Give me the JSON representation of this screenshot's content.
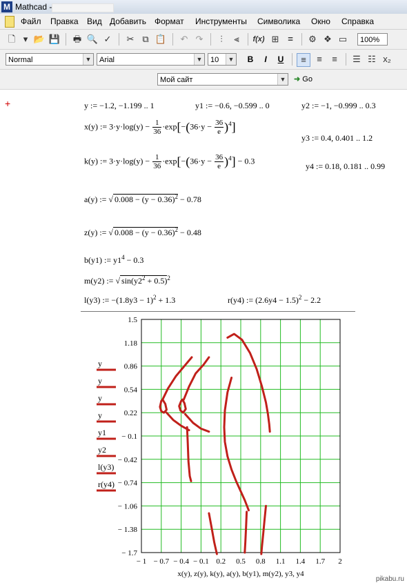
{
  "window": {
    "title": "Mathcad -"
  },
  "menu": {
    "items": [
      "Файл",
      "Правка",
      "Вид",
      "Добавить",
      "Формат",
      "Инструменты",
      "Символика",
      "Окно",
      "Справка"
    ]
  },
  "toolbar": {
    "zoom": "100%",
    "go_label": "Go"
  },
  "format_bar": {
    "style": "Normal",
    "font": "Arial",
    "size": "10",
    "bold": "B",
    "italic": "I",
    "underline": "U"
  },
  "resource_bar": {
    "site": "Мой сайт"
  },
  "equations": {
    "range_y": "y := −1.2, −1.199 .. 1",
    "range_y1": "y1 := −0.6, −0.599 .. 0",
    "range_y2": "y2 := −1, −0.999 .. 0.3",
    "range_y3": "y3 := 0.4, 0.401 .. 1.2",
    "range_y4": "y4 := 0.18, 0.181 .. 0.99",
    "x_def_left": "x(y) := 3·y·log(y) −",
    "x_frac_num": "1",
    "x_frac_den": "36",
    "x_def_mid": "·exp",
    "x_inner_left": "36·y −",
    "x_inner_frac_num": "36",
    "x_inner_frac_den": "e",
    "x_exp": "4",
    "k_def_left": "k(y) := 3·y·log(y) −",
    "k_frac_num": "1",
    "k_frac_den": "36",
    "k_def_mid": "·exp",
    "k_inner_left": "36·y −",
    "k_inner_frac_num": "36",
    "k_inner_frac_den": "e",
    "k_exp": "4",
    "k_tail": "− 0.3",
    "a_lhs": "a(y) :=",
    "a_radicand": "0.008 − (y − 0.36)",
    "a_exp": "2",
    "a_tail": "− 0.78",
    "z_lhs": "z(y) :=",
    "z_radicand": "0.008 − (y − 0.36)",
    "z_exp": "2",
    "z_tail": "− 0.48",
    "b_lhs": "b(y1) := y1",
    "b_exp": "4",
    "b_tail": "− 0.3",
    "m_lhs": "m(y2) :=",
    "m_radicand_left": "sin",
    "m_inner": "y2",
    "m_inner_exp": "2",
    "m_inner_tail": "+ 0.5",
    "m_exp": "2",
    "l_lhs": "l(y3) := −(1.8y3 − 1)",
    "l_exp": "2",
    "l_tail": "+ 1.3",
    "r_lhs": "r(y4) := (2.6y4 − 1.5)",
    "r_exp": "2",
    "r_tail": "− 2.2"
  },
  "chart_data": {
    "type": "line",
    "xlabel": "x(y), z(y), k(y), a(y), b(y1), m(y2), y3, y4",
    "legend": [
      "y",
      "y",
      "y",
      "y",
      "y1",
      "y2",
      "l(y3)",
      "r(y4)"
    ],
    "legend_placement": "left",
    "xlim": [
      -1,
      2
    ],
    "ylim": [
      -1.7,
      1.5
    ],
    "x_ticks": [
      "− 1",
      "− 0.7",
      "− 0.4",
      "− 0.1",
      "0.2",
      "0.5",
      "0.8",
      "1.1",
      "1.4",
      "1.7",
      "2"
    ],
    "y_ticks": [
      "1.5",
      "1.18",
      "0.86",
      "0.54",
      "0.22",
      "− 0.1",
      "− 0.42",
      "− 0.74",
      "− 1.06",
      "− 1.38",
      "− 1.7"
    ],
    "x_tick_values": [
      -1,
      -0.7,
      -0.4,
      -0.1,
      0.2,
      0.5,
      0.8,
      1.1,
      1.4,
      1.7,
      2
    ],
    "y_tick_values": [
      1.5,
      1.18,
      0.86,
      0.54,
      0.22,
      -0.1,
      -0.42,
      -0.74,
      -1.06,
      -1.38,
      -1.7
    ],
    "grid": true,
    "series_color": "#c0201a",
    "grid_color": "#22bb22",
    "series": [
      {
        "points": [
          [
            -0.7,
            0.38
          ],
          [
            -0.72,
            0.3
          ],
          [
            -0.7,
            0.24
          ],
          [
            -0.66,
            0.22
          ],
          [
            -0.62,
            0.26
          ],
          [
            -0.64,
            0.34
          ],
          [
            -0.68,
            0.4
          ],
          [
            -0.7,
            0.38
          ]
        ]
      },
      {
        "points": [
          [
            -0.4,
            0.38
          ],
          [
            -0.43,
            0.31
          ],
          [
            -0.41,
            0.25
          ],
          [
            -0.37,
            0.22
          ],
          [
            -0.33,
            0.27
          ],
          [
            -0.35,
            0.35
          ],
          [
            -0.38,
            0.4
          ],
          [
            -0.4,
            0.38
          ]
        ]
      },
      {
        "points": [
          [
            -0.68,
            0.4
          ],
          [
            -0.6,
            0.55
          ],
          [
            -0.48,
            0.72
          ],
          [
            -0.36,
            0.85
          ],
          [
            -0.24,
            0.98
          ]
        ]
      },
      {
        "points": [
          [
            -0.62,
            0.22
          ],
          [
            -0.52,
            0.12
          ],
          [
            -0.4,
            0.04
          ],
          [
            -0.28,
            -0.02
          ]
        ]
      },
      {
        "points": [
          [
            -0.36,
            0.4
          ],
          [
            -0.28,
            0.58
          ],
          [
            -0.18,
            0.76
          ],
          [
            -0.06,
            0.88
          ],
          [
            0.02,
            0.98
          ]
        ]
      },
      {
        "points": [
          [
            -0.34,
            0.2
          ],
          [
            -0.22,
            0.08
          ],
          [
            -0.1,
            0.0
          ],
          [
            0.02,
            -0.04
          ]
        ]
      },
      {
        "points": [
          [
            -0.31,
            0.02
          ],
          [
            -0.3,
            -0.2
          ],
          [
            -0.29,
            -0.45
          ],
          [
            -0.27,
            -0.65
          ],
          [
            -0.25,
            -0.72
          ]
        ]
      },
      {
        "points": [
          [
            0.3,
            1.25
          ],
          [
            0.4,
            1.3
          ],
          [
            0.52,
            1.22
          ],
          [
            0.64,
            1.04
          ],
          [
            0.74,
            0.82
          ],
          [
            0.82,
            0.58
          ],
          [
            0.88,
            0.36
          ],
          [
            0.91,
            0.2
          ],
          [
            0.93,
            0.06
          ],
          [
            0.94,
            -0.04
          ]
        ]
      },
      {
        "points": [
          [
            0.36,
            0.7
          ],
          [
            0.3,
            0.5
          ],
          [
            0.26,
            0.25
          ],
          [
            0.25,
            0.02
          ],
          [
            0.26,
            -0.18
          ],
          [
            0.3,
            -0.38
          ],
          [
            0.36,
            -0.56
          ],
          [
            0.43,
            -0.72
          ],
          [
            0.5,
            -0.86
          ],
          [
            0.56,
            -0.98
          ],
          [
            0.62,
            -1.12
          ]
        ]
      },
      {
        "points": [
          [
            0.59,
            -1.14
          ],
          [
            0.58,
            -1.35
          ],
          [
            0.57,
            -1.55
          ],
          [
            0.56,
            -1.7
          ]
        ]
      },
      {
        "points": [
          [
            0.02,
            -1.16
          ],
          [
            0.06,
            -1.36
          ],
          [
            0.1,
            -1.56
          ],
          [
            0.14,
            -1.72
          ]
        ]
      },
      {
        "points": [
          [
            0.88,
            -1.06
          ],
          [
            0.86,
            -1.24
          ],
          [
            0.84,
            -1.44
          ],
          [
            0.82,
            -1.62
          ],
          [
            0.81,
            -1.72
          ]
        ]
      }
    ]
  },
  "watermark": "pikabu.ru"
}
